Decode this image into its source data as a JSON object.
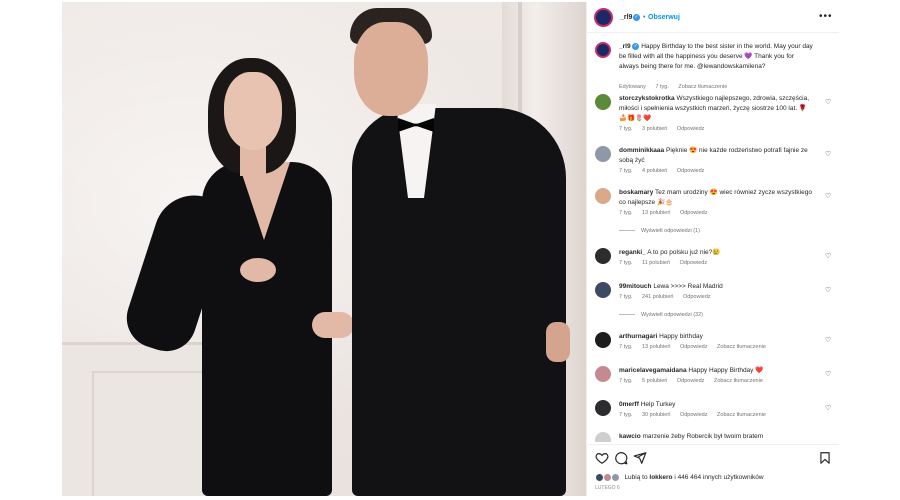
{
  "post": {
    "username": "_rl9",
    "follow_label": "Obserwuj",
    "more_label": "•••",
    "caption": {
      "text": "Happy Birthday to the best sister in the world. May your day be filled with all the happiness you deserve 💜 Thank you for always being there for me. @lewandowskamilena?",
      "edited": "Edytowany",
      "time": "7 tyg.",
      "translate": "Zobacz tłumaczenie"
    }
  },
  "comments": [
    {
      "username": "storczykstokrotka",
      "text": "Wszystkiego najlepszego, zdrowia, szczęścia, miłości i spełnienia wszystkich marzeń, życzę siostrze 100 lat. 🌹🍰🎁🌷❤️",
      "time": "7 tyg.",
      "likes": "3 polubień",
      "reply": "Odpowiedz",
      "avatar_color": "#5a8a3a"
    },
    {
      "username": "domminikkaaa",
      "text": "Pięknie 😍 nie każde rodzeństwo potrafi fajnie ze sobą żyć",
      "time": "7 tyg.",
      "likes": "4 polubień",
      "reply": "Odpowiedz",
      "avatar_color": "#8f98a8"
    },
    {
      "username": "boskamary",
      "text": "Tez mam urodziny 😍 wiec również zycze wszystkiego co najlepsze 🎉🎂",
      "time": "7 tyg.",
      "likes": "13 polubień",
      "reply": "Odpowiedz",
      "view_replies": "Wyświetl odpowiedzi (1)",
      "avatar_color": "#d9a98a"
    },
    {
      "username": "reganki_",
      "text": "A to po polsku już nie?😢",
      "time": "7 tyg.",
      "likes": "11 polubień",
      "reply": "Odpowiedz",
      "avatar_color": "#2d2d30"
    },
    {
      "username": "99mitouch",
      "text": "Lewa >>>> Real Madrid",
      "time": "7 tyg.",
      "likes": "241 polubień",
      "reply": "Odpowiedz",
      "view_replies": "Wyświetl odpowiedzi (32)",
      "avatar_color": "#3e4a62"
    },
    {
      "username": "arthurnagari",
      "text": "Happy birthday",
      "time": "7 tyg.",
      "likes": "13 polubień",
      "reply": "Odpowiedz",
      "translate": "Zobacz tłumaczenie",
      "avatar_color": "#1c1c1c"
    },
    {
      "username": "maricelavegamaidana",
      "text": "Happy Happy Birthday ❤️",
      "time": "7 tyg.",
      "likes": "5 polubień",
      "reply": "Odpowiedz",
      "translate": "Zobacz tłumaczenie",
      "avatar_color": "#c58a8f"
    },
    {
      "username": "0merff",
      "text": "Help Turkey",
      "time": "7 tyg.",
      "likes": "30 polubień",
      "reply": "Odpowiedz",
      "translate": "Zobacz tłumaczenie",
      "avatar_color": "#2d2d30"
    },
    {
      "username": "kawcio",
      "text": "marzenie żeby Robercik był twoim bratem",
      "time": "",
      "likes": "",
      "reply": "",
      "avatar_color": "#cfcfcf"
    }
  ],
  "likes_summary": {
    "prefix": "Lubią to",
    "user": "lokkero",
    "suffix": "i 446 464 innych użytkowników"
  },
  "date": "LUTEGO 6",
  "icons": [
    "heart-icon",
    "comment-icon",
    "share-icon",
    "bookmark-icon",
    "more-icon",
    "verified-icon"
  ],
  "colors": {
    "accent": "#0095f6",
    "verified": "#3797f0",
    "text": "#262626",
    "muted": "#737373",
    "like_heart": "#ed4956"
  }
}
